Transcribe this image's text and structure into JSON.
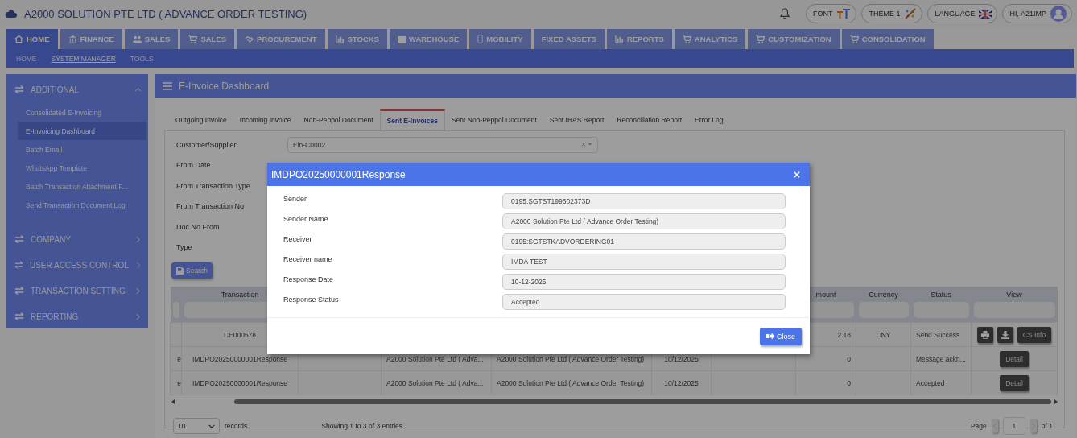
{
  "app_title": "A2000 SOLUTION PTE LTD ( ADVANCE ORDER TESTING)",
  "header_buttons": [
    {
      "kind": "font",
      "label": "FONT"
    },
    {
      "kind": "theme",
      "label": "THEME 1"
    },
    {
      "kind": "language",
      "label": "LANGUAGE"
    },
    {
      "kind": "user",
      "label": "HI, A21IMP"
    }
  ],
  "nav_tabs": [
    {
      "label": "HOME",
      "kind": "home",
      "selected": true
    },
    {
      "label": "FINANCE",
      "kind": "bank",
      "selected": false
    },
    {
      "label": "SALES",
      "kind": "people",
      "selected": false
    },
    {
      "label": "SALES",
      "kind": "cart",
      "selected": false
    },
    {
      "label": "PROCUREMENT",
      "kind": "hand",
      "selected": false
    },
    {
      "label": "STOCKS",
      "kind": "chart",
      "selected": false
    },
    {
      "label": "WAREHOUSE",
      "kind": "grid",
      "selected": false
    },
    {
      "label": "MOBILITY",
      "kind": "phone",
      "selected": false
    },
    {
      "label": "FIXED ASSETS",
      "kind": "plain",
      "selected": false
    },
    {
      "label": "REPORTS",
      "kind": "chart",
      "selected": false
    },
    {
      "label": "ANALYTICS",
      "kind": "cart",
      "selected": false
    },
    {
      "label": "CUSTOMIZATION",
      "kind": "cart",
      "selected": false
    },
    {
      "label": "CONSOLIDATION",
      "kind": "cart",
      "selected": false
    }
  ],
  "sub_nav": [
    {
      "label": "HOME",
      "selected": false
    },
    {
      "label": "SYSTEM MANAGER",
      "selected": true
    },
    {
      "label": "TOOLS",
      "selected": false
    }
  ],
  "sidebar": {
    "sections": [
      {
        "label": "ADDITIONAL",
        "expanded": true,
        "items": [
          {
            "label": "Consolidated E-Invoicing",
            "selected": false
          },
          {
            "label": "E-Invoicing Dashboard",
            "selected": true
          },
          {
            "label": "Batch Email",
            "selected": false
          },
          {
            "label": "WhatsApp Template",
            "selected": false
          },
          {
            "label": "Batch Transaction Attachment F...",
            "selected": false
          },
          {
            "label": "Send Transaction Document Log",
            "selected": false
          }
        ]
      },
      {
        "label": "COMPANY",
        "expanded": false
      },
      {
        "label": "USER ACCESS CONTROL",
        "expanded": false
      },
      {
        "label": "TRANSACTION SETTING",
        "expanded": false
      },
      {
        "label": "REPORTING",
        "expanded": false
      }
    ]
  },
  "panel_title": "E-Invoice Dashboard",
  "tabs": [
    {
      "label": "Outgoing Invoice",
      "selected": false
    },
    {
      "label": "Incoming Invoice",
      "selected": false
    },
    {
      "label": "Non-Peppol Document",
      "selected": false
    },
    {
      "label": "Sent E-Invoices",
      "selected": true
    },
    {
      "label": "Sent Non-Peppol Document",
      "selected": false
    },
    {
      "label": "Sent IRAS Report",
      "selected": false
    },
    {
      "label": "Reconciliation Report",
      "selected": false
    },
    {
      "label": "Error Log",
      "selected": false
    }
  ],
  "filters": [
    {
      "label": "Customer/Supplier",
      "value": "Ein-C0002"
    },
    {
      "label": "From Date"
    },
    {
      "label": "From Transaction Type"
    },
    {
      "label": "From Transaction No"
    },
    {
      "label": "Doc No From"
    },
    {
      "label": "Type"
    }
  ],
  "search_button": "Search",
  "table": {
    "columns": {
      "transaction": "Transaction",
      "amount": "mount",
      "currency": "Currency",
      "status": "Status",
      "view": "View"
    },
    "rows": [
      {
        "transaction": "CE000578",
        "amount": "2.18",
        "currency": "CNY",
        "status": "Send Success",
        "view": [
          {
            "kind": "print"
          },
          {
            "kind": "download"
          },
          {
            "kind": "text",
            "label": "CS Info"
          }
        ]
      },
      {
        "column_1": "e",
        "transaction": "IMDPO20250000001Response",
        "column_4": "A2000 Solution Pte Ltd ( Adva...",
        "column_5": "A2000 Solution Pte Ltd ( Advance Order Testing)",
        "column_6": "10/12/2025",
        "amount": "0",
        "status": "Message ackn...",
        "view": [
          {
            "kind": "text",
            "label": "Detail"
          }
        ]
      },
      {
        "column_1": "e",
        "transaction": "IMDPO20250000001Response",
        "column_4": "A2000 Solution Pte Ltd ( Adva...",
        "column_5": "A2000 Solution Pte Ltd ( Advance Order Testing)",
        "column_6": "10/12/2025",
        "amount": "0",
        "status": "Accepted",
        "view": [
          {
            "kind": "text",
            "label": "Detail"
          }
        ]
      }
    ]
  },
  "footer": {
    "page_size": "10",
    "records_label": "records",
    "info": "Showing 1 to 3 of 3 entries",
    "page_label": "Page",
    "page": "1",
    "page_total": "of 1"
  },
  "modal": {
    "title": "IMDPO20250000001Response",
    "fields": [
      {
        "label": "Sender",
        "value": "0195:SGTST199602373D"
      },
      {
        "label": "Sender Name",
        "value": "A2000 Solution Pte Ltd ( Advance Order Testing)"
      },
      {
        "label": "Receiver",
        "value": "0195:SGTSTKADVORDERING01"
      },
      {
        "label": "Receiver name",
        "value": "IMDA TEST"
      },
      {
        "label": "Response Date",
        "value": "10-12-2025"
      },
      {
        "label": "Response Status",
        "value": "Accepted"
      }
    ],
    "close_button": "Close"
  }
}
